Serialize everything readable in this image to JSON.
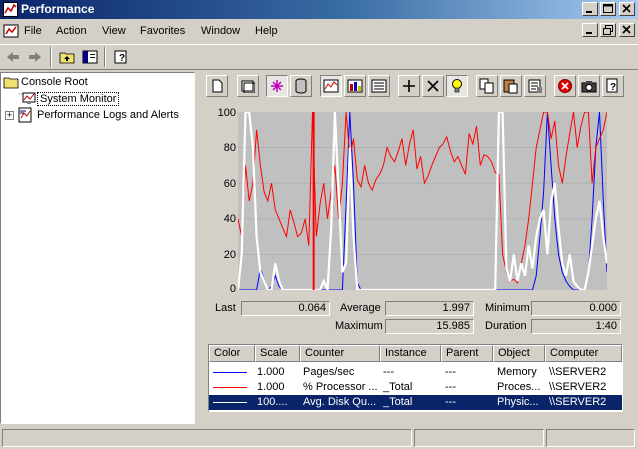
{
  "window": {
    "title": "Performance",
    "icon": "performance-app-icon",
    "buttons": [
      "minimize",
      "maximize",
      "close"
    ]
  },
  "menu": {
    "items": [
      "File",
      "Action",
      "View",
      "Favorites",
      "Window",
      "Help"
    ]
  },
  "toolbar1": {
    "icons": [
      "back-arrow-icon",
      "forward-arrow-icon",
      "up-folder-icon",
      "show-hide-tree-icon",
      "help-icon"
    ]
  },
  "tree": {
    "root": "Console Root",
    "items": [
      "System Monitor",
      "Performance Logs and Alerts"
    ],
    "expander": "+"
  },
  "monitor_toolbar": {
    "icons": [
      "new-counter-set-icon",
      "clear-display-icon",
      "view-current-activity-icon",
      "view-log-data-icon",
      "view-graph-icon",
      "view-histogram-icon",
      "view-report-icon",
      "add-counter-icon",
      "delete-counter-icon",
      "highlight-icon",
      "copy-properties-icon",
      "paste-counter-list-icon",
      "properties-icon",
      "freeze-display-icon",
      "update-data-icon",
      "help-icon"
    ]
  },
  "graph": {
    "yticks": [
      "100",
      "80",
      "60",
      "40",
      "20",
      "0"
    ],
    "background": "#c0c0c0"
  },
  "stats": {
    "last_label": "Last",
    "last_value": "0.064",
    "average_label": "Average",
    "average_value": "1.997",
    "minimum_label": "Minimum",
    "minimum_value": "0.000",
    "maximum_label": "Maximum",
    "maximum_value": "15.985",
    "duration_label": "Duration",
    "duration_value": "1:40"
  },
  "legend": {
    "headers": [
      "Color",
      "Scale",
      "Counter",
      "Instance",
      "Parent",
      "Object",
      "Computer"
    ],
    "rows": [
      {
        "color": "#0000ff",
        "scale": "1.000",
        "counter": "Pages/sec",
        "instance": "---",
        "parent": "---",
        "object": "Memory",
        "computer": "\\\\SERVER2"
      },
      {
        "color": "#ff0000",
        "scale": "1.000",
        "counter": "% Processor ...",
        "instance": "_Total",
        "parent": "---",
        "object": "Proces...",
        "computer": "\\\\SERVER2"
      },
      {
        "color": "#ffffff",
        "scale": "100....",
        "counter": "Avg. Disk Qu...",
        "instance": "_Total",
        "parent": "---",
        "object": "Physic...",
        "computer": "\\\\SERVER2"
      }
    ]
  },
  "chart_data": {
    "type": "line",
    "ylim": [
      0,
      100
    ],
    "x": [
      0,
      1,
      2,
      3,
      4,
      5,
      6,
      7,
      8,
      9,
      10,
      11,
      12,
      13,
      14,
      15,
      16,
      17,
      18,
      19,
      20,
      21,
      22,
      23,
      24,
      25,
      26,
      27,
      28,
      29,
      30,
      31,
      32,
      33,
      34,
      35,
      36,
      37,
      38,
      39,
      40,
      41,
      42,
      43,
      44,
      45,
      46,
      47,
      48,
      49,
      50,
      51,
      52,
      53,
      54,
      55,
      56,
      57,
      58,
      59,
      60,
      61,
      62,
      63,
      64,
      65,
      66,
      67,
      68,
      69,
      70,
      71,
      72,
      73,
      74,
      75,
      76,
      77,
      78,
      79,
      80,
      81,
      82,
      83,
      84,
      85,
      86,
      87,
      88,
      89,
      90,
      91,
      92,
      93,
      94,
      95,
      96,
      97,
      98,
      99
    ],
    "series": [
      {
        "color": "#0000ff",
        "values": [
          0,
          0,
          0,
          0,
          0,
          0,
          12,
          6,
          0,
          2,
          8,
          2,
          0,
          0,
          0,
          0,
          0,
          0,
          0,
          0,
          0,
          0,
          0,
          0,
          0,
          0,
          0,
          0,
          0,
          48,
          100,
          60,
          4,
          0,
          0,
          0,
          0,
          0,
          0,
          0,
          0,
          0,
          0,
          0,
          0,
          0,
          0,
          0,
          0,
          0,
          0,
          0,
          0,
          0,
          0,
          0,
          0,
          0,
          0,
          0,
          0,
          0,
          0,
          0,
          0,
          0,
          0,
          0,
          0,
          0,
          0,
          0,
          0,
          0,
          0,
          0,
          0,
          0,
          0,
          0,
          8,
          30,
          55,
          100,
          70,
          40,
          20,
          10,
          5,
          2,
          0,
          0,
          0,
          0,
          10,
          40,
          80,
          100,
          50,
          10
        ]
      },
      {
        "color": "#ff0000",
        "values": [
          40,
          30,
          70,
          50,
          60,
          90,
          70,
          55,
          50,
          60,
          45,
          40,
          35,
          30,
          45,
          38,
          30,
          32,
          40,
          25,
          100,
          30,
          48,
          60,
          40,
          55,
          70,
          40,
          60,
          100,
          75,
          85,
          62,
          58,
          70,
          60,
          56,
          62,
          65,
          70,
          80,
          75,
          72,
          78,
          85,
          70,
          82,
          90,
          68,
          75,
          60,
          64,
          70,
          75,
          80,
          82,
          86,
          78,
          72,
          75,
          70,
          65,
          88,
          82,
          92,
          70,
          76,
          75,
          72,
          66,
          65,
          20,
          10,
          5,
          6,
          4,
          15,
          25,
          40,
          60,
          80,
          90,
          100,
          100,
          85,
          95,
          70,
          60,
          75,
          88,
          100,
          80,
          92,
          100,
          100,
          60,
          80,
          85,
          90,
          100
        ]
      },
      {
        "color": "#ffffff",
        "values": [
          0,
          20,
          100,
          100,
          80,
          30,
          10,
          5,
          0,
          0,
          15,
          5,
          0,
          0,
          0,
          0,
          0,
          0,
          0,
          0,
          0,
          0,
          0,
          5,
          0,
          35,
          100,
          55,
          10,
          15,
          80,
          30,
          0,
          0,
          0,
          0,
          0,
          0,
          0,
          0,
          0,
          0,
          0,
          0,
          0,
          0,
          0,
          0,
          0,
          0,
          0,
          0,
          0,
          0,
          0,
          0,
          0,
          0,
          0,
          0,
          0,
          0,
          0,
          0,
          0,
          0,
          0,
          0,
          0,
          0,
          100,
          100,
          12,
          5,
          20,
          5,
          15,
          8,
          25,
          12,
          30,
          40,
          45,
          20,
          50,
          60,
          35,
          15,
          8,
          20,
          5,
          2,
          0,
          0,
          10,
          25,
          40,
          50,
          30,
          15
        ]
      }
    ]
  }
}
